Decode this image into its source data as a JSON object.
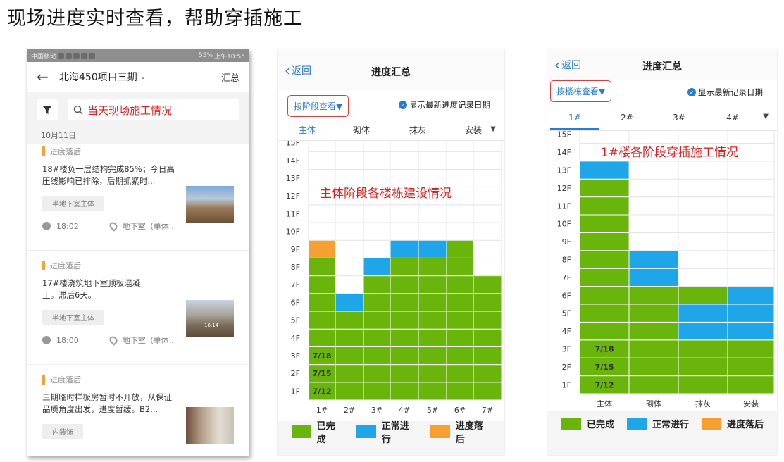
{
  "page_title": "现场进度实时查看，帮助穿插施工",
  "colors": {
    "done": "#6ab50c",
    "normal": "#1ea6e9",
    "delay": "#f5a030",
    "accent": "#2a7bd1",
    "annotation": "#e02020"
  },
  "phone1": {
    "statusbar": {
      "carrier": "中国移动",
      "battery": "55%",
      "time": "上午10:55"
    },
    "nav": {
      "project": "北海450项目三期",
      "summary": "汇总"
    },
    "search": {
      "text": "当天现场施工情况"
    },
    "date": "10月11日",
    "items": [
      {
        "status": "进度落后",
        "desc": "18#楼负一层结构完成85%；今日高压线影响已排除，后期抓紧时...",
        "chip": "半地下室主体",
        "time": "18:02",
        "location": "地下室（单体..."
      },
      {
        "status": "进度落后",
        "desc": "17#楼浇筑地下室顶板混凝土。滞后6天。",
        "chip": "半地下室主体",
        "time": "18:00",
        "location": "地下室（单体...",
        "photo_caption": "16:14"
      },
      {
        "status": "进度落后",
        "desc": "三期临时样板房暂时不开放，从保证品质角度出发，进度暂缓。B2...",
        "chip": "内装饰"
      }
    ]
  },
  "phone2": {
    "back": "返回",
    "title": "进度汇总",
    "view_button": "按阶段查看▼",
    "show_date": "显示最新进度记录日期",
    "tabs": [
      "主体",
      "砌体",
      "抹灰",
      "安装"
    ],
    "annotation": "主体阶段各楼栋建设情况",
    "legend": [
      "已完成",
      "正常进行",
      "进度落后"
    ]
  },
  "phone3": {
    "back": "返回",
    "title": "进度汇总",
    "view_button": "按楼栋查看▼",
    "show_date": "显示最新记录日期",
    "tabs": [
      "1#",
      "2#",
      "3#",
      "4#"
    ],
    "annotation": "1#楼各阶段穿插施工情况",
    "legend": [
      "已完成",
      "正常进行",
      "进度落后"
    ]
  },
  "chart_data": [
    {
      "type": "heatmap",
      "title": "",
      "floors": [
        "1F",
        "2F",
        "3F",
        "4F",
        "5F",
        "6F",
        "7F",
        "8F",
        "9F",
        "10F",
        "11F",
        "12F",
        "13F",
        "14F",
        "15F"
      ],
      "columns": [
        "1#",
        "2#",
        "3#",
        "4#",
        "5#",
        "6#",
        "7#"
      ],
      "status_legend": {
        "0": "empty",
        "1": "已完成",
        "2": "正常进行",
        "3": "进度落后"
      },
      "cells": [
        [
          1,
          1,
          1,
          1,
          1,
          1,
          1
        ],
        [
          1,
          1,
          1,
          1,
          1,
          1,
          1
        ],
        [
          1,
          1,
          1,
          1,
          1,
          1,
          1
        ],
        [
          1,
          1,
          1,
          1,
          1,
          1,
          1
        ],
        [
          1,
          1,
          1,
          1,
          1,
          1,
          1
        ],
        [
          1,
          2,
          1,
          1,
          1,
          1,
          1
        ],
        [
          1,
          0,
          1,
          1,
          1,
          1,
          1
        ],
        [
          1,
          0,
          2,
          1,
          1,
          1,
          0
        ],
        [
          3,
          0,
          0,
          2,
          2,
          1,
          0
        ],
        [
          0,
          0,
          0,
          0,
          0,
          0,
          0
        ],
        [
          0,
          0,
          0,
          0,
          0,
          0,
          0
        ],
        [
          0,
          0,
          0,
          0,
          0,
          0,
          0
        ],
        [
          0,
          0,
          0,
          0,
          0,
          0,
          0
        ],
        [
          0,
          0,
          0,
          0,
          0,
          0,
          0
        ],
        [
          0,
          0,
          0,
          0,
          0,
          0,
          0
        ]
      ],
      "labels": [
        {
          "floor": "1F",
          "column": "1#",
          "text": "7/12"
        },
        {
          "floor": "2F",
          "column": "1#",
          "text": "7/15"
        },
        {
          "floor": "3F",
          "column": "1#",
          "text": "7/18"
        }
      ]
    },
    {
      "type": "heatmap",
      "title": "",
      "floors": [
        "1F",
        "2F",
        "3F",
        "4F",
        "5F",
        "6F",
        "7F",
        "8F",
        "9F",
        "10F",
        "11F",
        "12F",
        "13F",
        "14F",
        "15F"
      ],
      "columns": [
        "主体",
        "砌体",
        "抹灰",
        "安装"
      ],
      "status_legend": {
        "0": "empty",
        "1": "已完成",
        "2": "正常进行",
        "3": "进度落后"
      },
      "cells": [
        [
          1,
          1,
          1,
          1
        ],
        [
          1,
          1,
          1,
          1
        ],
        [
          1,
          1,
          1,
          1
        ],
        [
          1,
          1,
          2,
          2
        ],
        [
          1,
          1,
          2,
          2
        ],
        [
          1,
          1,
          1,
          2
        ],
        [
          1,
          2,
          0,
          0
        ],
        [
          1,
          2,
          0,
          0
        ],
        [
          1,
          0,
          0,
          0
        ],
        [
          1,
          0,
          0,
          0
        ],
        [
          1,
          0,
          0,
          0
        ],
        [
          1,
          0,
          0,
          0
        ],
        [
          2,
          0,
          0,
          0
        ],
        [
          0,
          0,
          0,
          0
        ],
        [
          0,
          0,
          0,
          0
        ]
      ],
      "labels": [
        {
          "floor": "1F",
          "column": "主体",
          "text": "7/12"
        },
        {
          "floor": "2F",
          "column": "主体",
          "text": "7/15"
        },
        {
          "floor": "3F",
          "column": "主体",
          "text": "7/18"
        }
      ]
    }
  ]
}
